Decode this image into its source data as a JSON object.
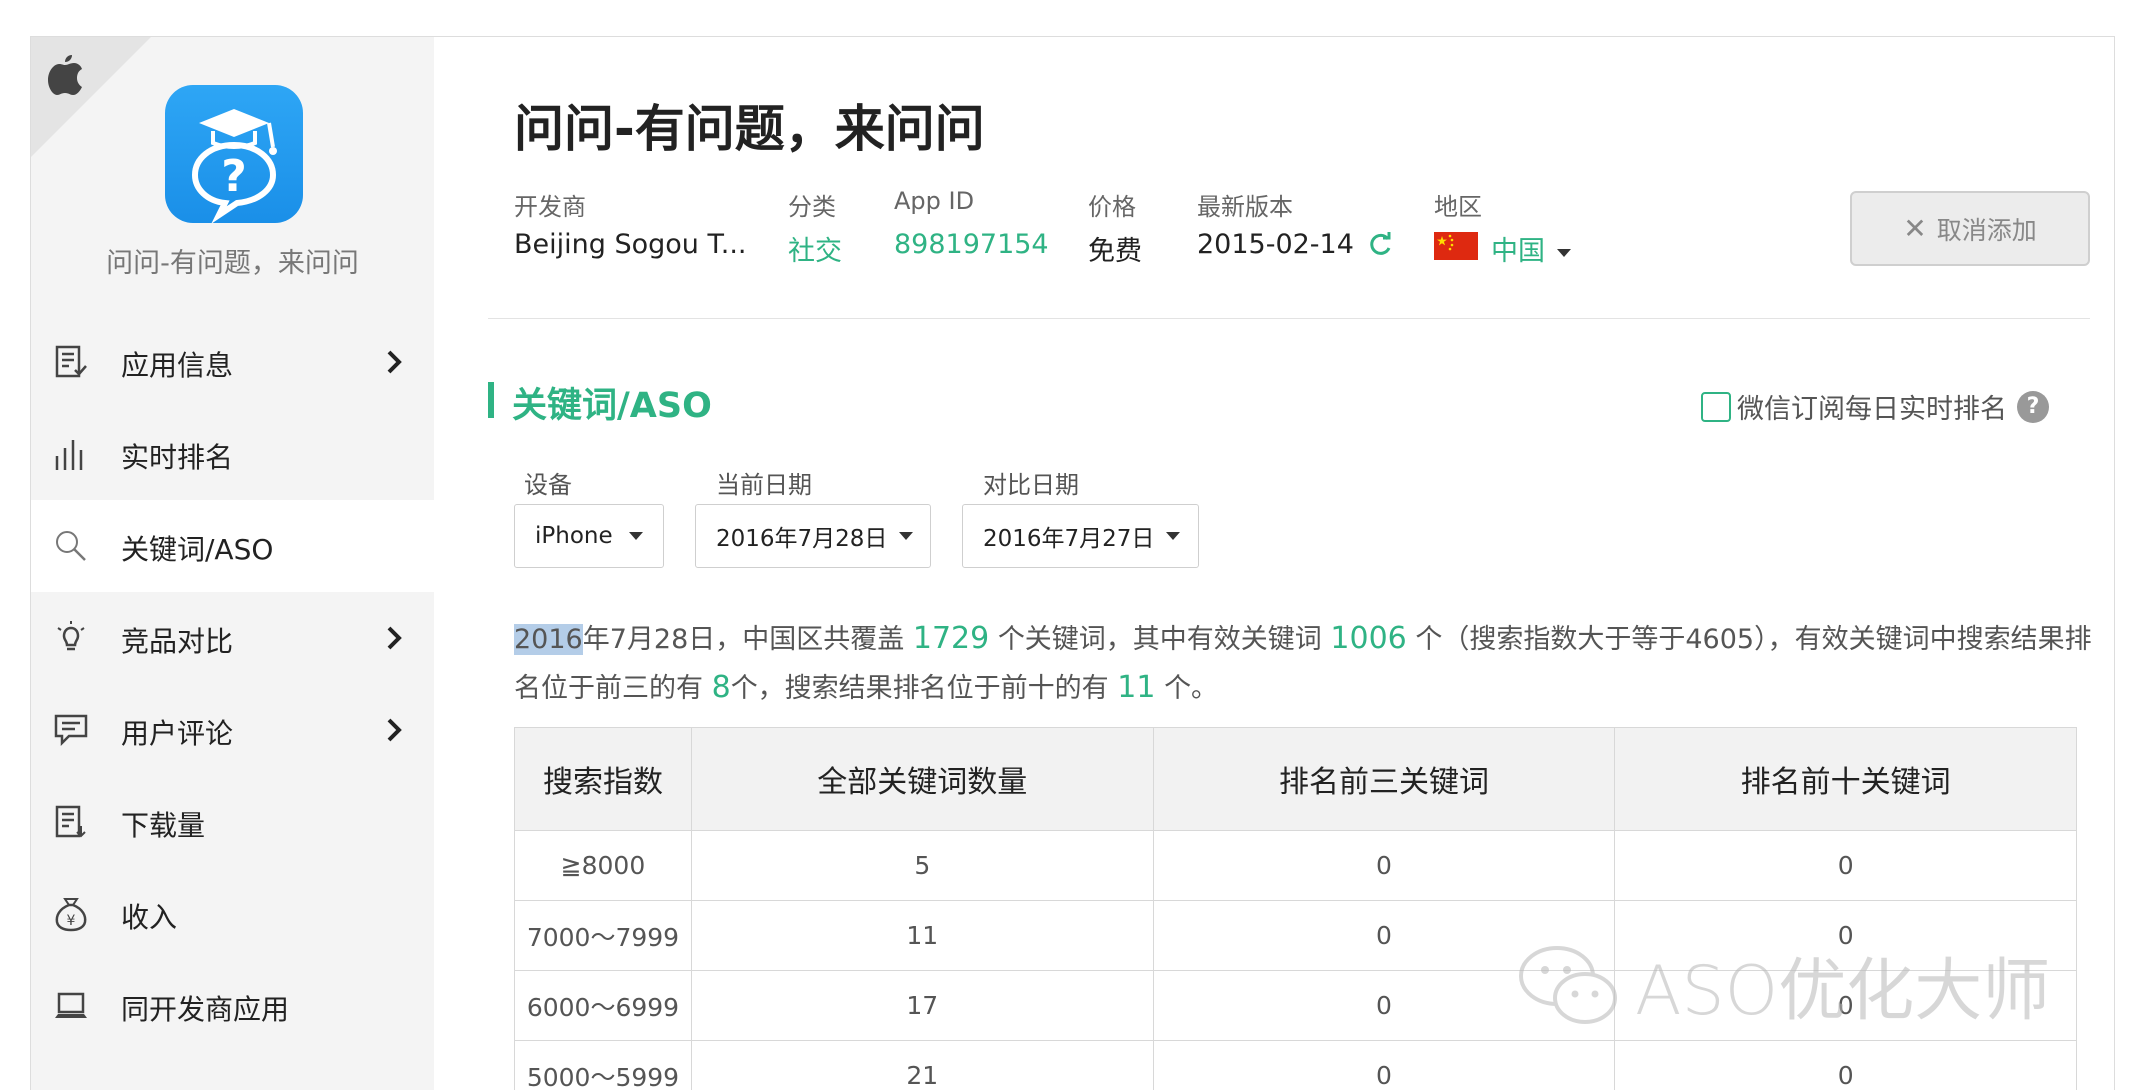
{
  "app": {
    "name": "问问-有问题，来问问",
    "title": "问问-有问题，来问问"
  },
  "sidebar": {
    "items": [
      {
        "label": "应用信息",
        "icon": "document-check-icon",
        "has_chevron": true
      },
      {
        "label": "实时排名",
        "icon": "bar-chart-icon",
        "has_chevron": false
      },
      {
        "label": "关键词/ASO",
        "icon": "search-icon",
        "has_chevron": false,
        "active": true
      },
      {
        "label": "竞品对比",
        "icon": "lightbulb-icon",
        "has_chevron": true
      },
      {
        "label": "用户评论",
        "icon": "comment-icon",
        "has_chevron": true
      },
      {
        "label": "下载量",
        "icon": "download-document-icon",
        "has_chevron": false
      },
      {
        "label": "收入",
        "icon": "money-bag-icon",
        "has_chevron": false
      },
      {
        "label": "同开发商应用",
        "icon": "laptop-icon",
        "has_chevron": false
      }
    ]
  },
  "meta": {
    "developer_label": "开发商",
    "developer_value": "Beijing Sogou T...",
    "category_label": "分类",
    "category_value": "社交",
    "appid_label": "App ID",
    "appid_value": "898197154",
    "price_label": "价格",
    "price_value": "免费",
    "version_label": "最新版本",
    "version_value": "2015-02-14",
    "region_label": "地区",
    "region_value": "中国"
  },
  "actions": {
    "cancel_add": "取消添加"
  },
  "section": {
    "title": "关键词/ASO",
    "wechat_subscribe": "微信订阅每日实时排名"
  },
  "filters": {
    "device_label": "设备",
    "device_value": "iPhone",
    "current_date_label": "当前日期",
    "current_date_value": "2016年7月28日",
    "compare_date_label": "对比日期",
    "compare_date_value": "2016年7月27日"
  },
  "summary": {
    "year_highlight": "2016",
    "part1": "年7月28日，中国区共覆盖",
    "total_keywords": "1729",
    "part2": "个关键词，其中有效关键词",
    "effective_keywords": "1006",
    "part3": "个（搜索指数大于等于4605），有效关键词中搜索结果排名位于前三的有",
    "top3": "8",
    "part4": "个，搜索结果排名位于前十的有",
    "top10": "11",
    "part5": "个。"
  },
  "table": {
    "headers": [
      "搜索指数",
      "全部关键词数量",
      "排名前三关键词",
      "排名前十关键词"
    ],
    "rows": [
      [
        "≧8000",
        "5",
        "0",
        "0"
      ],
      [
        "7000～7999",
        "11",
        "0",
        "0"
      ],
      [
        "6000～6999",
        "17",
        "0",
        "0"
      ],
      [
        "5000～5999",
        "21",
        "0",
        "0"
      ]
    ]
  },
  "watermark": {
    "text": "ASO优化大师"
  },
  "colors": {
    "accent": "#2fb384",
    "app_icon": "#1a8fe8",
    "sidebar_bg": "#f4f4f4"
  }
}
